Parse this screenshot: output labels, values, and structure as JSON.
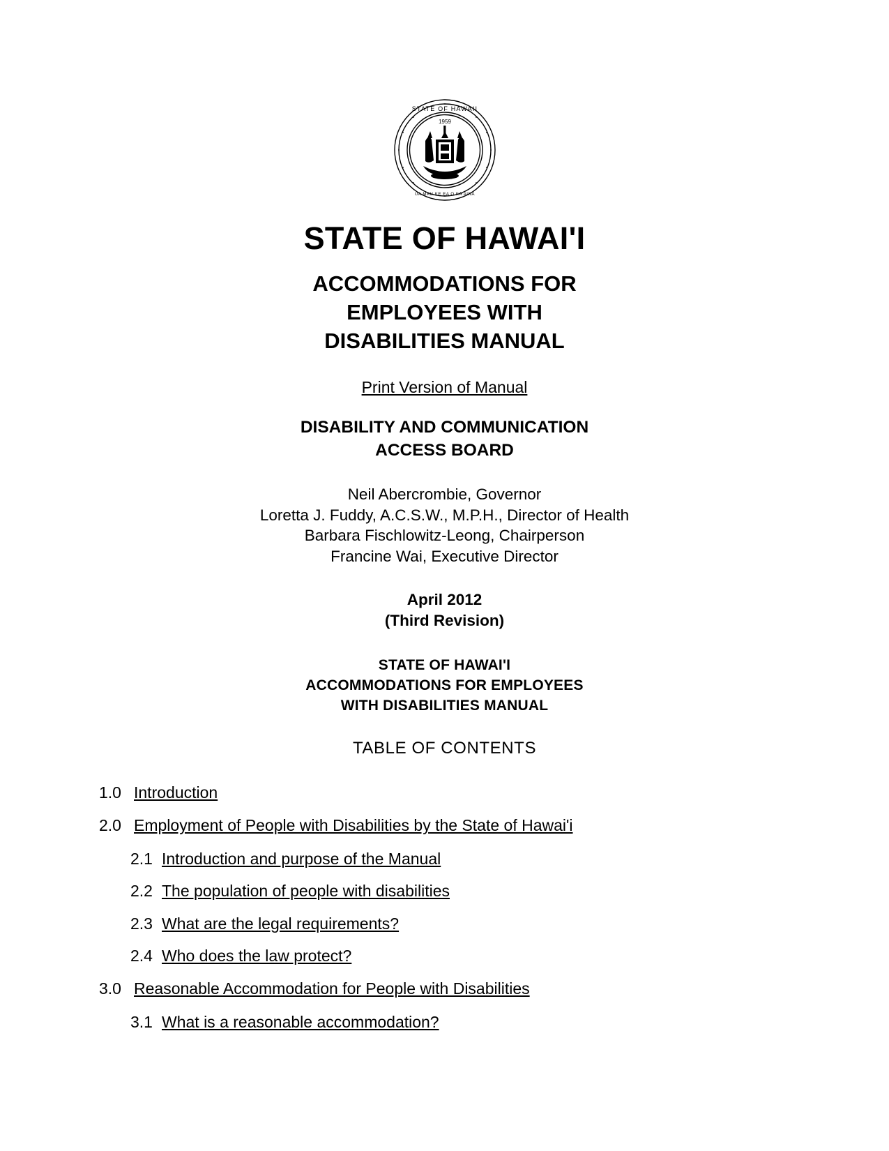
{
  "document": {
    "seal": {
      "icon": "state-of-hawaii-seal",
      "rim_text_top": "STATE OF HAWAII",
      "year": "1959",
      "rim_text_bottom": "UA MAU KE EA O KA AINA I KA PONO"
    },
    "main_title": "STATE OF HAWAI'I",
    "subtitle_lines": [
      "ACCOMMODATIONS FOR",
      "EMPLOYEES WITH",
      "DISABILITIES MANUAL"
    ],
    "print_version_link": "Print Version of Manual",
    "board_lines": [
      "DISABILITY AND COMMUNICATION",
      "ACCESS BOARD"
    ],
    "officials": [
      "Neil Abercrombie, Governor",
      "Loretta J. Fuddy, A.C.S.W., M.P.H., Director of Health",
      "Barbara Fischlowitz-Leong, Chairperson",
      "Francine Wai, Executive Director"
    ],
    "date_lines": [
      "April 2012",
      "(Third Revision)"
    ],
    "second_title_lines": [
      "STATE OF HAWAI'I",
      "ACCOMMODATIONS FOR EMPLOYEES",
      "WITH DISABILITIES MANUAL"
    ],
    "toc_heading": "TABLE OF CONTENTS",
    "toc": [
      {
        "number": "1.0",
        "title": "Introduction",
        "level": 1
      },
      {
        "number": "2.0",
        "title": "Employment of People with Disabilities by the State of Hawai'i",
        "level": 1
      },
      {
        "number": "2.1",
        "title": "Introduction and purpose of the Manual",
        "level": 2
      },
      {
        "number": "2.2",
        "title": "The population of people with disabilities",
        "level": 2
      },
      {
        "number": "2.3",
        "title": "What are the legal requirements?",
        "level": 2
      },
      {
        "number": "2.4",
        "title": "Who does the law protect?",
        "level": 2
      },
      {
        "number": "3.0",
        "title": "Reasonable Accommodation for People with Disabilities",
        "level": 1
      },
      {
        "number": "3.1",
        "title": "What is a reasonable accommodation?",
        "level": 2
      }
    ]
  }
}
